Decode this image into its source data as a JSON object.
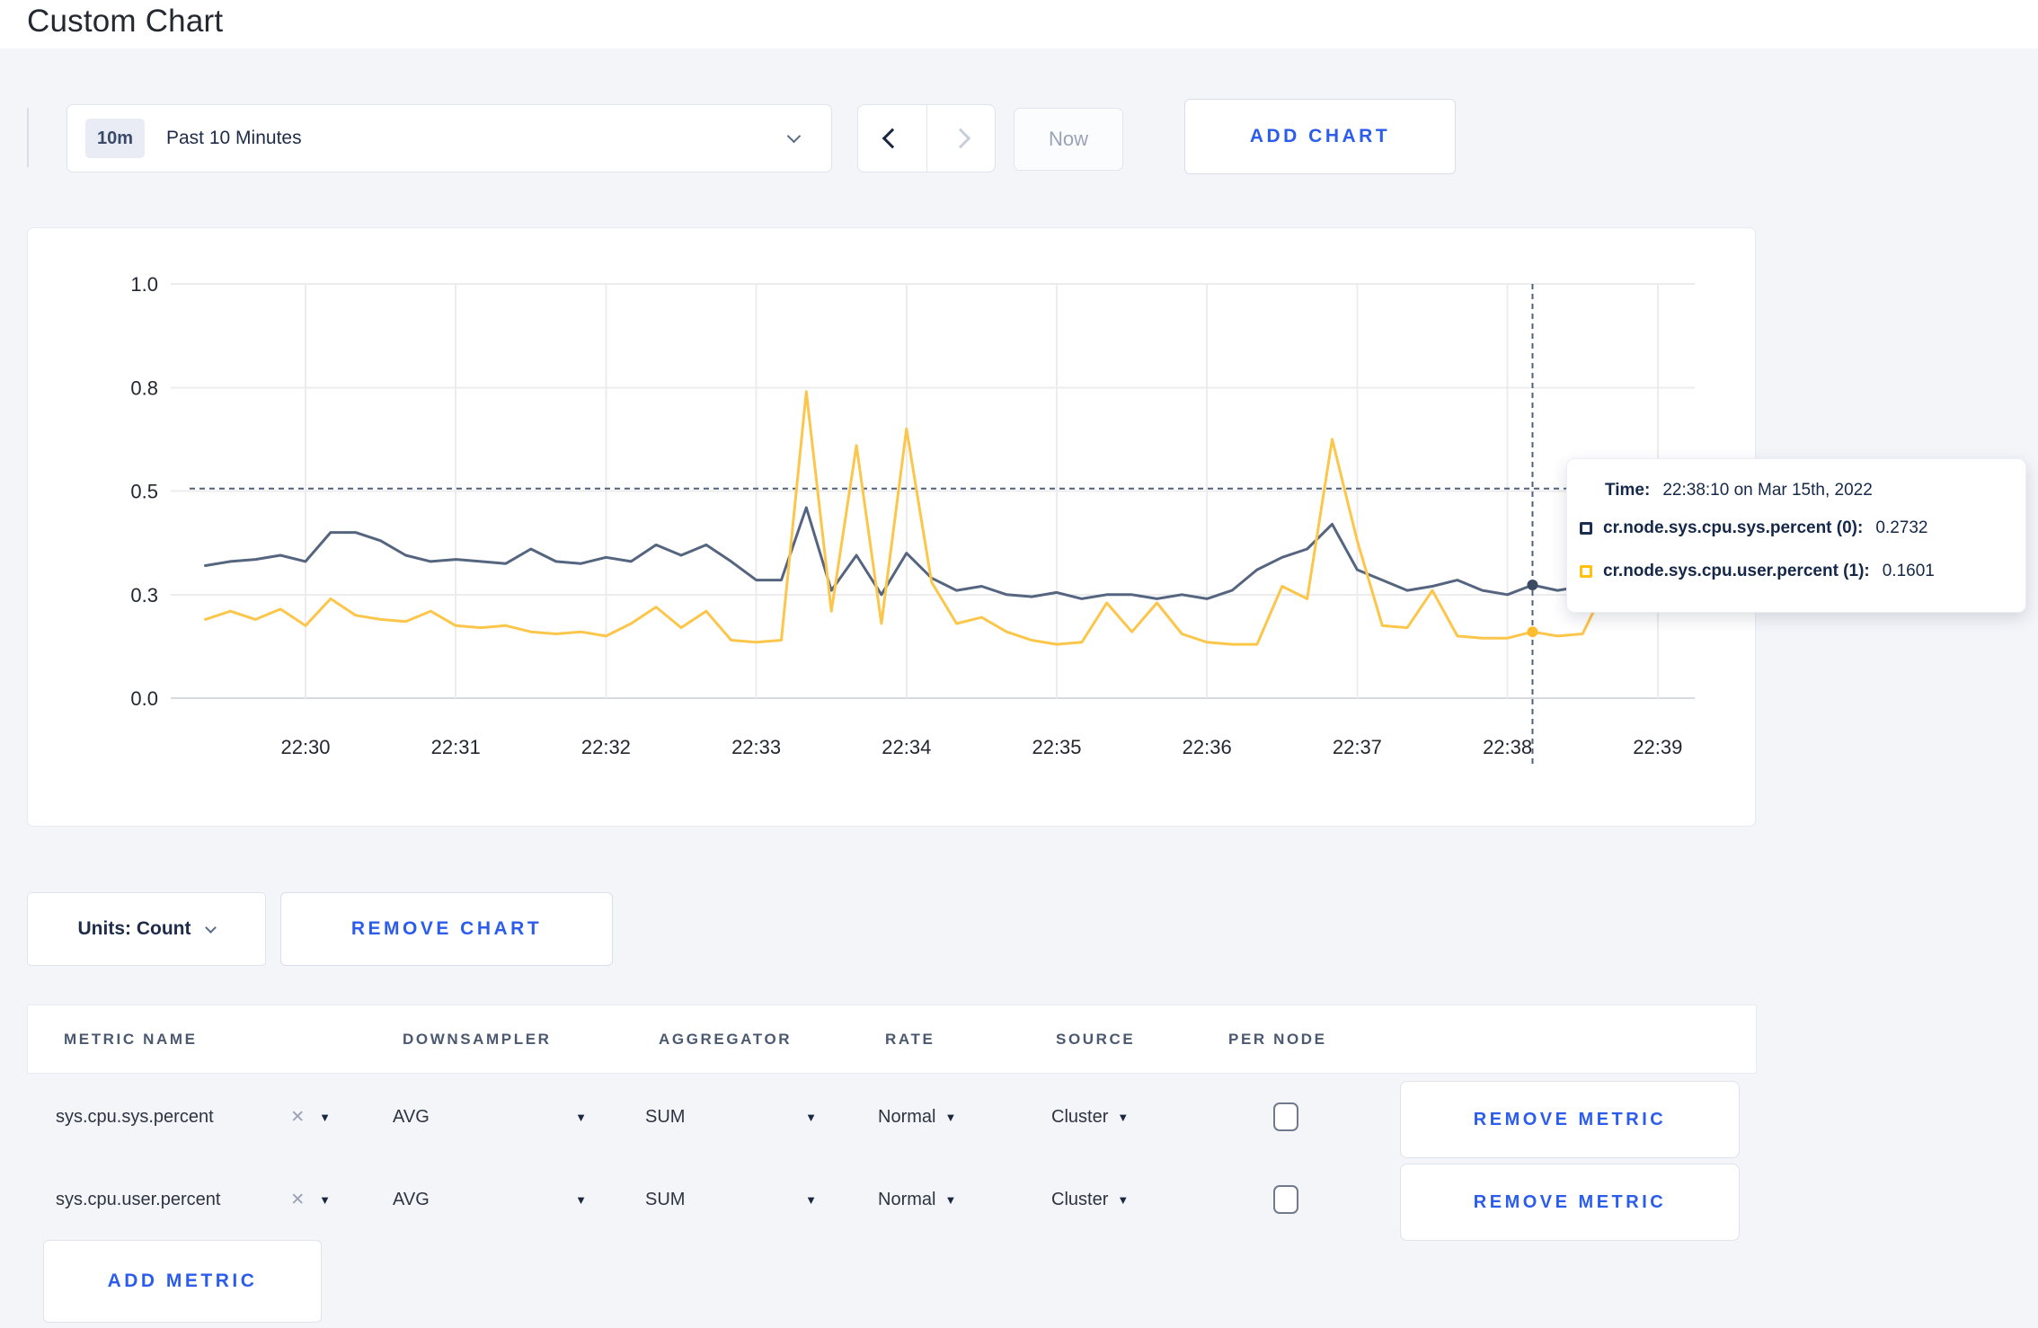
{
  "page": {
    "title": "Custom Chart"
  },
  "toolbar": {
    "time_range_badge": "10m",
    "time_range_label": "Past 10 Minutes",
    "now_label": "Now",
    "add_chart_label": "ADD CHART"
  },
  "chart_controls": {
    "units_label": "Units: Count",
    "remove_chart_label": "REMOVE CHART"
  },
  "chart_data": {
    "type": "line",
    "title": "",
    "xlabel": "",
    "ylabel": "",
    "grid": true,
    "legend_position": "tooltip",
    "x_axis": {
      "tick_labels": [
        "22:30",
        "22:31",
        "22:32",
        "22:33",
        "22:34",
        "22:35",
        "22:36",
        "22:37",
        "22:38",
        "22:39"
      ]
    },
    "y_axis": {
      "range": [
        0,
        1
      ],
      "ticks": [
        {
          "value": 0,
          "label": "0.0"
        },
        {
          "value": 0.25,
          "label": "0.3"
        },
        {
          "value": 0.5,
          "label": "0.5"
        },
        {
          "value": 0.75,
          "label": "0.8"
        },
        {
          "value": 1.0,
          "label": "1.0"
        }
      ]
    },
    "x_start_minutes": -0.66667,
    "x_step_minutes": 0.166667,
    "series": [
      {
        "name": "cr.node.sys.cpu.sys.percent",
        "color": "#55657f",
        "dot_color": "#3c4a63",
        "values": [
          0.32,
          0.33,
          0.335,
          0.345,
          0.33,
          0.4,
          0.4,
          0.38,
          0.345,
          0.33,
          0.335,
          0.33,
          0.325,
          0.36,
          0.33,
          0.325,
          0.34,
          0.33,
          0.37,
          0.345,
          0.37,
          0.33,
          0.285,
          0.285,
          0.46,
          0.26,
          0.345,
          0.25,
          0.35,
          0.29,
          0.26,
          0.27,
          0.25,
          0.245,
          0.255,
          0.24,
          0.25,
          0.25,
          0.24,
          0.25,
          0.24,
          0.26,
          0.31,
          0.34,
          0.36,
          0.42,
          0.31,
          0.285,
          0.26,
          0.27,
          0.285,
          0.26,
          0.25,
          0.2732,
          0.26,
          0.27,
          0.26,
          0.28,
          0.24,
          0.27
        ]
      },
      {
        "name": "cr.node.sys.cpu.user.percent",
        "color": "#fcc64a",
        "dot_color": "#fdbd2f",
        "values": [
          0.19,
          0.21,
          0.19,
          0.215,
          0.175,
          0.24,
          0.2,
          0.19,
          0.185,
          0.21,
          0.175,
          0.17,
          0.175,
          0.16,
          0.155,
          0.16,
          0.15,
          0.18,
          0.22,
          0.17,
          0.21,
          0.14,
          0.135,
          0.14,
          0.74,
          0.21,
          0.61,
          0.18,
          0.65,
          0.28,
          0.18,
          0.195,
          0.16,
          0.14,
          0.13,
          0.135,
          0.23,
          0.16,
          0.23,
          0.155,
          0.135,
          0.13,
          0.13,
          0.27,
          0.24,
          0.625,
          0.38,
          0.175,
          0.17,
          0.26,
          0.15,
          0.145,
          0.145,
          0.1601,
          0.15,
          0.155,
          0.28,
          0.28,
          0.26,
          0.33
        ]
      }
    ],
    "hover": {
      "time_prefix": "Time:",
      "time_label": "22:38:10 on Mar 15th, 2022",
      "x_minutes": 8.166667,
      "crosshair_y_value": 0.506,
      "readings": [
        {
          "label": "cr.node.sys.cpu.sys.percent (0):",
          "value": "0.2732",
          "color": "#1c2e52"
        },
        {
          "label": "cr.node.sys.cpu.user.percent (1):",
          "value": "0.1601",
          "color": "#ffc10a"
        }
      ]
    }
  },
  "metrics_table": {
    "headers": [
      "METRIC NAME",
      "DOWNSAMPLER",
      "AGGREGATOR",
      "RATE",
      "SOURCE",
      "PER NODE"
    ],
    "rows": [
      {
        "metric_name": "sys.cpu.sys.percent",
        "downsampler": "AVG",
        "aggregator": "SUM",
        "rate": "Normal",
        "source": "Cluster",
        "per_node_checked": false,
        "remove_label": "REMOVE METRIC"
      },
      {
        "metric_name": "sys.cpu.user.percent",
        "downsampler": "AVG",
        "aggregator": "SUM",
        "rate": "Normal",
        "source": "Cluster",
        "per_node_checked": false,
        "remove_label": "REMOVE METRIC"
      }
    ],
    "add_metric_label": "ADD METRIC"
  }
}
